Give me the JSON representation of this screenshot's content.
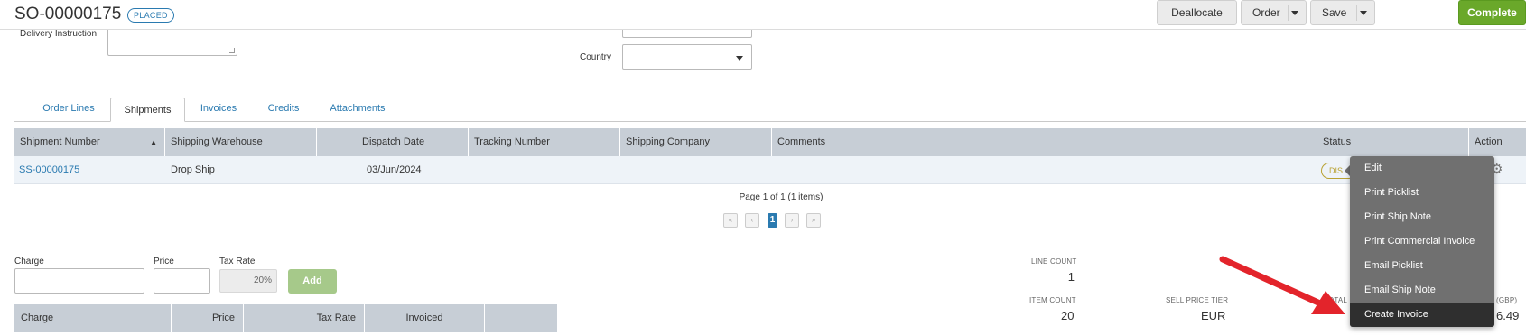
{
  "header": {
    "title": "SO-00000175",
    "status": "PLACED",
    "buttons": {
      "deallocate": "Deallocate",
      "order": "Order",
      "save": "Save",
      "complete": "Complete"
    }
  },
  "form": {
    "delivery_instruction_label": "Delivery Instruction",
    "country_label": "Country"
  },
  "tabs": [
    "Order Lines",
    "Shipments",
    "Invoices",
    "Credits",
    "Attachments"
  ],
  "shipments_table": {
    "headers": [
      "Shipment Number",
      "Shipping Warehouse",
      "Dispatch Date",
      "Tracking Number",
      "Shipping Company",
      "Comments",
      "Status",
      "Action"
    ],
    "rows": [
      {
        "shipment_number": "SS-00000175",
        "warehouse": "Drop Ship",
        "dispatch_date": "03/Jun/2024",
        "tracking": "",
        "company": "",
        "comments": "",
        "status": "DIS"
      }
    ]
  },
  "pager": {
    "text": "Page 1 of 1 (1 items)",
    "current": "1",
    "first": "«",
    "prev": "‹",
    "next": "›",
    "last": "»"
  },
  "charge_form": {
    "charge_label": "Charge",
    "price_label": "Price",
    "tax_rate_label": "Tax Rate",
    "tax_rate_value": "20%",
    "add_label": "Add"
  },
  "charges_table": {
    "headers": [
      "Charge",
      "Price",
      "Tax Rate",
      "Invoiced"
    ]
  },
  "summary": {
    "line_count_label": "LINE COUNT",
    "line_count": "1",
    "item_count_label": "ITEM COUNT",
    "item_count": "20",
    "sell_price_tier_label": "SELL PRICE TIER",
    "sell_price_tier": "EUR",
    "total_label_partial": "TOTAL",
    "gbp_label_partial": "(GBP)",
    "total_value_partial": "6.49"
  },
  "action_menu": {
    "items": [
      "Edit",
      "Print Picklist",
      "Print Ship Note",
      "Print Commercial Invoice",
      "Email Picklist",
      "Email Ship Note",
      "Create Invoice"
    ],
    "selected_index": 6
  },
  "colors": {
    "accent": "#2a7ab0",
    "complete": "#6aa82a",
    "table_header": "#c7ced6",
    "menu": "#707070",
    "arrow": "#e3242b"
  },
  "icons": {
    "sort": "sort-asc-icon",
    "gear": "gear-icon",
    "caret": "caret-down-icon"
  }
}
